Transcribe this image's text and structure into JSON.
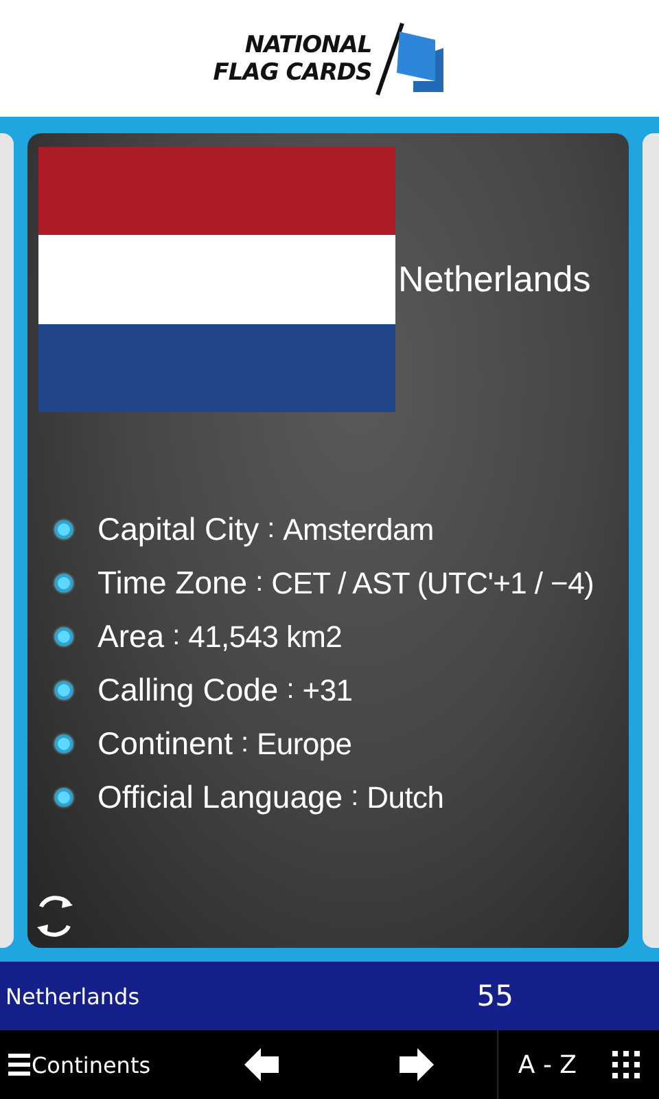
{
  "logo": {
    "line_1": "NATIONAL",
    "line_2": "FLAG CARDS"
  },
  "card": {
    "flag": {
      "stripes": [
        {
          "color": "#ae1c28"
        },
        {
          "color": "#ffffff"
        },
        {
          "color": "#21468b"
        }
      ]
    },
    "country": "Netherlands",
    "facts": [
      {
        "label": "Capital City",
        "separator": ":",
        "value": "Amsterdam"
      },
      {
        "label": "Time Zone",
        "separator": ":",
        "value": "CET / AST (UTC'+1 / −4)"
      },
      {
        "label": "Area",
        "separator": ":",
        "value": "41,543 km2"
      },
      {
        "label": "Calling Code",
        "separator": ":",
        "value": "+31"
      },
      {
        "label": "Continent",
        "separator": ":",
        "value": "Europe"
      },
      {
        "label": "Official Language",
        "separator": ":",
        "value": "Dutch"
      }
    ]
  },
  "status_bar": {
    "country": "Netherlands",
    "count": "55"
  },
  "toolbar": {
    "continents": "Continents",
    "sort": "A - Z"
  }
}
